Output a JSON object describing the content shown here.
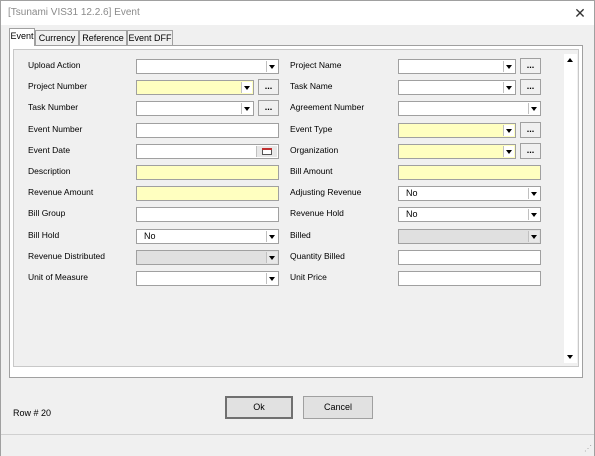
{
  "window": {
    "title": "[Tsunami VIS31 12.2.6] Event",
    "close_glyph": "✕"
  },
  "tabs": [
    {
      "label": "Event",
      "active": true
    },
    {
      "label": "Currency",
      "active": false
    },
    {
      "label": "Reference",
      "active": false
    },
    {
      "label": "Event DFF",
      "active": false
    }
  ],
  "left_fields": [
    {
      "label": "Upload Action",
      "value": "",
      "kind": "dropdown",
      "style": "normal"
    },
    {
      "label": "Project Number",
      "value": "",
      "kind": "dropdown-lookup",
      "style": "required"
    },
    {
      "label": "Task Number",
      "value": "",
      "kind": "dropdown-lookup",
      "style": "normal"
    },
    {
      "label": "Event Number",
      "value": "",
      "kind": "text",
      "style": "normal"
    },
    {
      "label": "Event Date",
      "value": "",
      "kind": "date",
      "style": "normal"
    },
    {
      "label": "Description",
      "value": "",
      "kind": "text",
      "style": "required"
    },
    {
      "label": "Revenue Amount",
      "value": "",
      "kind": "text",
      "style": "required"
    },
    {
      "label": "Bill Group",
      "value": "",
      "kind": "text",
      "style": "normal"
    },
    {
      "label": "Bill Hold",
      "value": "No",
      "kind": "dropdown",
      "style": "normal"
    },
    {
      "label": "Revenue Distributed",
      "value": "",
      "kind": "dropdown",
      "style": "disabled"
    },
    {
      "label": "Unit of Measure",
      "value": "",
      "kind": "dropdown",
      "style": "normal"
    }
  ],
  "right_fields": [
    {
      "label": "Project Name",
      "value": "",
      "kind": "dropdown-lookup",
      "style": "normal"
    },
    {
      "label": "Task Name",
      "value": "",
      "kind": "dropdown-lookup",
      "style": "normal"
    },
    {
      "label": "Agreement Number",
      "value": "",
      "kind": "dropdown",
      "style": "normal"
    },
    {
      "label": "Event Type",
      "value": "",
      "kind": "dropdown-lookup",
      "style": "required"
    },
    {
      "label": "Organization",
      "value": "",
      "kind": "dropdown-lookup",
      "style": "required"
    },
    {
      "label": "Bill Amount",
      "value": "",
      "kind": "text",
      "style": "required"
    },
    {
      "label": "Adjusting Revenue",
      "value": "No",
      "kind": "dropdown",
      "style": "normal"
    },
    {
      "label": "Revenue Hold",
      "value": "No",
      "kind": "dropdown",
      "style": "normal"
    },
    {
      "label": "Billed",
      "value": "",
      "kind": "dropdown",
      "style": "disabled"
    },
    {
      "label": "Quantity Billed",
      "value": "",
      "kind": "text",
      "style": "normal"
    },
    {
      "label": "Unit Price",
      "value": "",
      "kind": "text",
      "style": "normal"
    }
  ],
  "lookup_button_label": "...",
  "buttons": {
    "ok": "Ok",
    "cancel": "Cancel"
  },
  "status": {
    "row_text": "Row # 20"
  },
  "colors": {
    "required": "#ffffc0",
    "disabled": "#e0e0e0",
    "title_text": "#8a8a8a"
  }
}
